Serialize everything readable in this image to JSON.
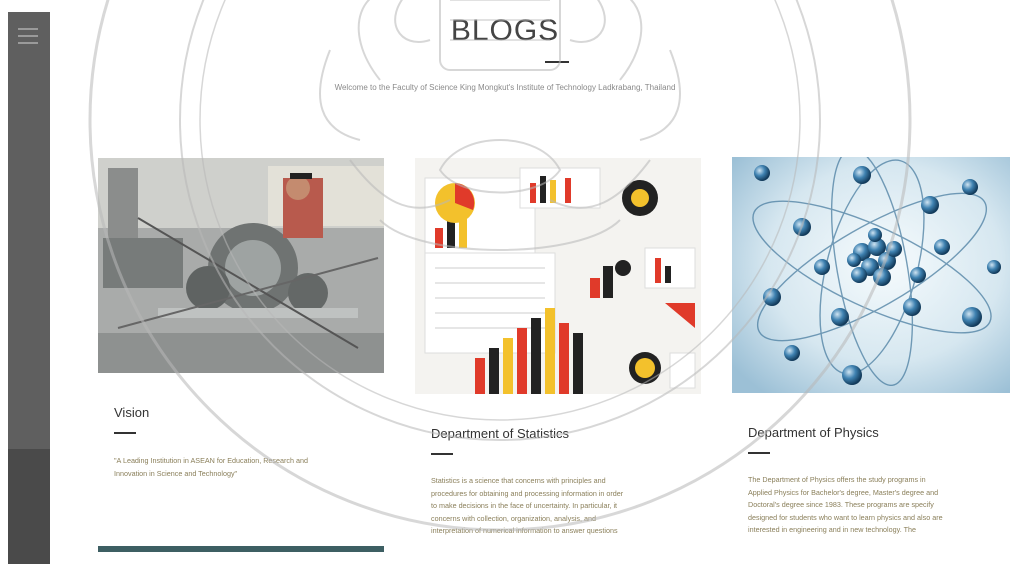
{
  "sidebar": {
    "menu_icon": "hamburger-menu-icon"
  },
  "header": {
    "title": "BLOGS",
    "welcome": "Welcome to the Faculty of Science King Mongkut's Institute of Technology Ladkrabang, Thailand"
  },
  "cards": [
    {
      "title": "Vision",
      "body_lines": [
        "\"A Leading Institution in ASEAN for Education, Research and",
        "Innovation in Science and Technology\""
      ],
      "image_icon": "laboratory-equipment-photo"
    },
    {
      "title": "Department of Statistics",
      "body_lines": [
        "Statistics is a science that concerns with principles and",
        "procedures for obtaining and processing information in order",
        "to make decisions in the face of uncertainty. In particular, it",
        "concerns with collection, organization, analysis, and",
        "interpretation of numerical information to answer questions"
      ],
      "image_icon": "statistics-charts-photo"
    },
    {
      "title": "Department of Physics",
      "body_lines": [
        "The Department of Physics offers the study programs in",
        "Applied Physics for Bachelor's degree, Master's degree and",
        "Doctoral's degree since 1983. These programs are specify",
        "designed for students who want to learn physics and also are",
        "interested in engineering and in new technology. The"
      ],
      "image_icon": "atom-model-photo"
    }
  ],
  "colors": {
    "sidebar": "#5f5f5f",
    "atom_bg": "#e9f2f7",
    "atom_sphere": "#2f6f9c"
  }
}
